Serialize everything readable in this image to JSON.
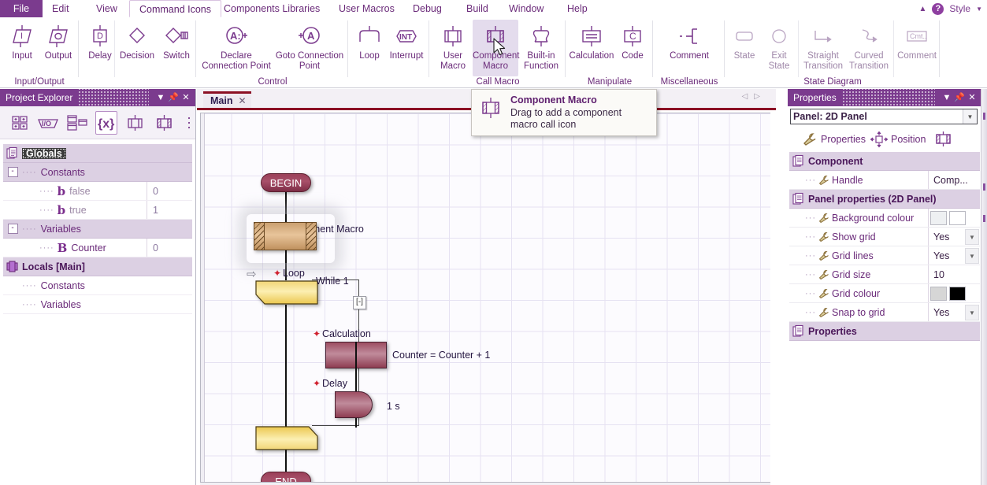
{
  "menu": {
    "items": [
      "File",
      "Edit",
      "View",
      "Command Icons",
      "Components Libraries",
      "User Macros",
      "Debug",
      "Build",
      "Window",
      "Help"
    ],
    "active": "Command Icons",
    "style_label": "Style",
    "help_icon": "help-circle-icon",
    "collapse_icon": "chevron-up-icon"
  },
  "ribbon": {
    "groups": [
      {
        "label": "Input/Output",
        "items": [
          {
            "label": "Input",
            "icon": "input-parallelogram-icon"
          },
          {
            "label": "Output",
            "icon": "output-parallelogram-icon"
          }
        ]
      },
      {
        "label": "",
        "items": [
          {
            "label": "Delay",
            "icon": "delay-d-icon"
          },
          {
            "label": "Decision",
            "icon": "decision-diamond-icon"
          },
          {
            "label": "Switch",
            "icon": "switch-diamond-icon"
          }
        ]
      },
      {
        "label": "Control",
        "items": [
          {
            "label": "Declare Connection Point",
            "icon": "declare-connection-point-icon"
          },
          {
            "label": "Goto Connection Point",
            "icon": "goto-connection-point-icon"
          }
        ]
      },
      {
        "label": "",
        "items": [
          {
            "label": "Loop",
            "icon": "loop-icon"
          },
          {
            "label": "Interrupt",
            "icon": "interrupt-int-icon"
          }
        ]
      },
      {
        "label": "Call Macro",
        "items": [
          {
            "label": "User Macro",
            "icon": "user-macro-icon"
          },
          {
            "label": "Component Macro",
            "icon": "component-macro-icon",
            "selected": true
          },
          {
            "label": "Built-in Function",
            "icon": "built-in-function-icon"
          }
        ]
      },
      {
        "label": "Manipulate",
        "items": [
          {
            "label": "Calculation",
            "icon": "calculation-icon"
          },
          {
            "label": "Code",
            "icon": "code-c-icon"
          }
        ]
      },
      {
        "label": "Miscellaneous",
        "items": [
          {
            "label": "Comment",
            "icon": "comment-bracket-icon"
          }
        ]
      },
      {
        "label": "State Diagram",
        "items": [
          {
            "label": "State",
            "icon": "state-rect-icon",
            "dim": true
          },
          {
            "label": "Exit State",
            "icon": "exit-state-circle-icon",
            "dim": true
          },
          {
            "label": "Straight Transition",
            "icon": "straight-transition-icon",
            "dim": true
          },
          {
            "label": "Curved Transition",
            "icon": "curved-transition-icon",
            "dim": true
          },
          {
            "label": "Comment",
            "icon": "state-comment-icon",
            "dim": true
          }
        ]
      }
    ]
  },
  "project_explorer": {
    "title": "Project Explorer",
    "title_buttons": [
      "dropdown-icon",
      "pin-icon",
      "close-icon"
    ],
    "toolbar": [
      {
        "icon": "panels-grid-icon",
        "active": false
      },
      {
        "icon": "io-icon",
        "active": false
      },
      {
        "icon": "windows-layout-icon",
        "active": false
      },
      {
        "icon": "variables-braces-icon",
        "active": true
      },
      {
        "icon": "macro-icon",
        "active": false
      },
      {
        "icon": "component-macro-icon",
        "active": false
      },
      {
        "icon": "overflow-dots-icon",
        "active": false
      }
    ],
    "tree": [
      {
        "type": "group",
        "label": "Globals",
        "icon": "folder-stack-icon",
        "selected": true
      },
      {
        "type": "section",
        "label": "Constants",
        "expander": "-"
      },
      {
        "type": "leaf",
        "label": "false",
        "icon": "bool-b-icon",
        "value": "0"
      },
      {
        "type": "leaf",
        "label": "true",
        "icon": "bool-b-icon",
        "value": "1"
      },
      {
        "type": "section",
        "label": "Variables",
        "expander": "-"
      },
      {
        "type": "leaf",
        "label": "Counter",
        "icon": "byte-b-icon",
        "value": "0"
      },
      {
        "type": "group",
        "label": "Locals [Main]",
        "icon": "macro-block-icon"
      },
      {
        "type": "section",
        "label": "Constants"
      },
      {
        "type": "section",
        "label": "Variables"
      }
    ]
  },
  "editor": {
    "tab": {
      "name": "Main",
      "close_icon": "close-icon"
    },
    "nav": {
      "prev": "◁",
      "next": "▷"
    }
  },
  "flowchart": {
    "nodes": [
      {
        "id": "begin",
        "type": "terminator",
        "text": "BEGIN"
      },
      {
        "id": "cmacro",
        "type": "component-macro",
        "label": "Component Macro",
        "starred": true
      },
      {
        "id": "loop",
        "type": "loop-start",
        "label": "Loop",
        "starred": true,
        "condition": "While 1"
      },
      {
        "id": "calc",
        "type": "calculation",
        "label": "Calculation",
        "starred": true,
        "expression": "Counter = Counter + 1"
      },
      {
        "id": "delay",
        "type": "delay",
        "label": "Delay",
        "starred": true,
        "value": "1 s"
      },
      {
        "id": "loopend",
        "type": "loop-end"
      },
      {
        "id": "end",
        "type": "terminator",
        "text": "END"
      }
    ],
    "collapse_marker": "[-]"
  },
  "tooltip": {
    "title": "Component Macro",
    "body": "Drag to add a component macro call icon",
    "icon": "component-macro-icon"
  },
  "properties": {
    "title": "Properties",
    "title_buttons": [
      "dropdown-icon",
      "pin-icon",
      "close-icon"
    ],
    "selector_value": "Panel: 2D Panel",
    "tabs": [
      {
        "label": "Properties",
        "icon": "wrench-icon"
      },
      {
        "label": "Position",
        "icon": "move-arrows-icon"
      },
      {
        "label": "",
        "icon": "component-macro-icon"
      }
    ],
    "rows": [
      {
        "kind": "group",
        "label": "Component",
        "icon": "folder-stack-icon"
      },
      {
        "kind": "prop",
        "label": "Handle",
        "icon": "wrench-icon",
        "value": "Comp...",
        "control": "text"
      },
      {
        "kind": "group",
        "label": "Panel properties (2D Panel)",
        "icon": "folder-stack-icon"
      },
      {
        "kind": "prop",
        "label": "Background colour",
        "icon": "wrench-icon",
        "control": "colour",
        "colour1": "#eef0f2",
        "colour2": "#ffffff"
      },
      {
        "kind": "prop",
        "label": "Show grid",
        "icon": "wrench-icon",
        "value": "Yes",
        "control": "dropdown"
      },
      {
        "kind": "prop",
        "label": "Grid lines",
        "icon": "wrench-icon",
        "value": "Yes",
        "control": "dropdown"
      },
      {
        "kind": "prop",
        "label": "Grid size",
        "icon": "wrench-icon",
        "value": "10",
        "control": "text"
      },
      {
        "kind": "prop",
        "label": "Grid colour",
        "icon": "wrench-icon",
        "control": "colour",
        "colour1": "#d6d6d6",
        "colour2": "#000000"
      },
      {
        "kind": "prop",
        "label": "Snap to grid",
        "icon": "wrench-icon",
        "value": "Yes",
        "control": "dropdown"
      },
      {
        "kind": "group",
        "label": "Properties",
        "icon": "folder-stack-icon"
      }
    ]
  },
  "theme": {
    "accent": "#7b3b8e",
    "menu_text": "#6a2a79",
    "group_row": "#dcd0e3",
    "tab_underline": "#8c1024",
    "canvas_grid": "#e6e2f2"
  }
}
